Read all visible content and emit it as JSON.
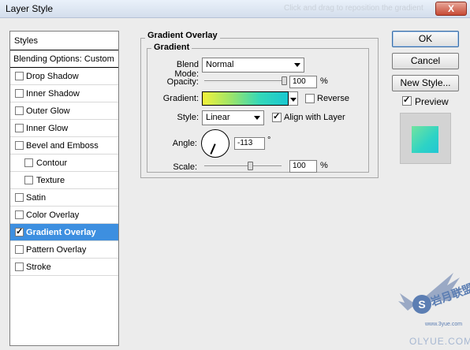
{
  "window": {
    "title": "Layer Style",
    "faint_text": "Click and drag to reposition the gradient",
    "close_label": "X"
  },
  "styles_list": {
    "header": "Styles",
    "blending": "Blending Options: Custom",
    "items": [
      {
        "label": "Drop Shadow",
        "checked": false,
        "indent": false,
        "selected": false
      },
      {
        "label": "Inner Shadow",
        "checked": false,
        "indent": false,
        "selected": false
      },
      {
        "label": "Outer Glow",
        "checked": false,
        "indent": false,
        "selected": false
      },
      {
        "label": "Inner Glow",
        "checked": false,
        "indent": false,
        "selected": false
      },
      {
        "label": "Bevel and Emboss",
        "checked": false,
        "indent": false,
        "selected": false
      },
      {
        "label": "Contour",
        "checked": false,
        "indent": true,
        "selected": false
      },
      {
        "label": "Texture",
        "checked": false,
        "indent": true,
        "selected": false
      },
      {
        "label": "Satin",
        "checked": false,
        "indent": false,
        "selected": false
      },
      {
        "label": "Color Overlay",
        "checked": false,
        "indent": false,
        "selected": false
      },
      {
        "label": "Gradient Overlay",
        "checked": true,
        "indent": false,
        "selected": true
      },
      {
        "label": "Pattern Overlay",
        "checked": false,
        "indent": false,
        "selected": false
      },
      {
        "label": "Stroke",
        "checked": false,
        "indent": false,
        "selected": false
      }
    ]
  },
  "panel": {
    "outer_title": "Gradient Overlay",
    "inner_title": "Gradient",
    "blend_mode_label": "Blend Mode:",
    "blend_mode_value": "Normal",
    "opacity_label": "Opacity:",
    "opacity_value": "100",
    "opacity_fraction": 1.0,
    "percent": "%",
    "gradient_label": "Gradient:",
    "gradient_colors": [
      "#f2f23a",
      "#19c7d0"
    ],
    "reverse_label": "Reverse",
    "reverse_checked": false,
    "style_label": "Style:",
    "style_value": "Linear",
    "align_label": "Align with Layer",
    "align_checked": true,
    "angle_label": "Angle:",
    "angle_value": "-113",
    "degree": "°",
    "scale_label": "Scale:",
    "scale_value": "100",
    "scale_fraction": 0.6
  },
  "buttons": {
    "ok": "OK",
    "cancel": "Cancel",
    "new_style": "New Style...",
    "preview_label": "Preview",
    "preview_checked": true
  },
  "watermark": {
    "brand": "岩月联盟",
    "url": "www.3yue.com",
    "site": "OLYUE.COM"
  }
}
